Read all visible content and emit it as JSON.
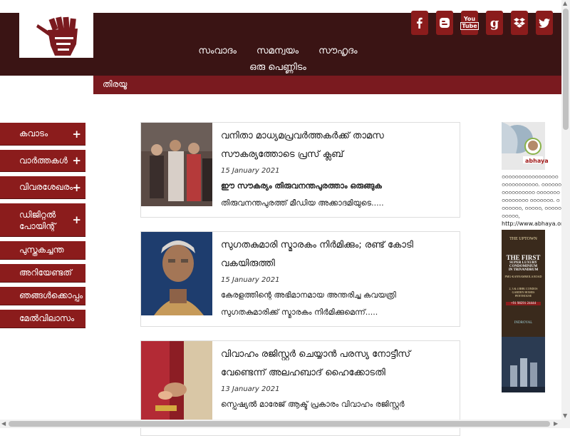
{
  "header": {
    "nav_row1": [
      "സംവാദം",
      "സമന്വയം",
      "സൗഹൃദം"
    ],
    "nav_row2": [
      "ഒരു പെണ്ണിടം"
    ],
    "social": [
      "facebook-icon",
      "blogger-icon",
      "youtube-icon",
      "google-icon",
      "dropbox-icon",
      "twitter-icon"
    ],
    "social_labels": {
      "youtube_top": "You",
      "youtube_bottom": "Tube",
      "google": "g"
    },
    "accent": "#3a1414",
    "button_color": "#8b1c1c"
  },
  "subbar": {
    "label": "തിരയൂ"
  },
  "sidemenu": [
    {
      "label": "കവാടം",
      "plus": "+"
    },
    {
      "label": "വാർത്തകൾ",
      "plus": "+"
    },
    {
      "label": "വിവരശേഖരം",
      "plus": "+"
    },
    {
      "label": "ഡിജിറ്റൽ പോയിന്റ്",
      "plus": "+"
    },
    {
      "label": "പുസ്തകച്ചന്ത",
      "plus": ""
    },
    {
      "label": "അറിയേണ്ടത്",
      "plus": ""
    },
    {
      "label": "ഞങ്ങൾക്കൊപ്പം",
      "plus": ""
    },
    {
      "label": "മേൽവിലാസം",
      "plus": ""
    }
  ],
  "articles": [
    {
      "title": "വനിതാ മാധ്യമപ്രവർത്തകർക്ക് താമസ സൗകര്യത്തോടെ പ്രസ് ക്ലബ്",
      "date": "15 January 2021",
      "excerpt_bold": "ഈ സൗകര്യം തിരുവനന്തപുരത്താം ഒരുങ്ങുക",
      "excerpt": "തിരുവനന്തപുരത്ത് മീഡിയ അക്കാദമിയുടെ....."
    },
    {
      "title": "സുഗതകുമാരി സ്മാരകം നിർമിക്കും; രണ്ട് കോടി വകയിരുത്തി",
      "date": "15 January 2021",
      "excerpt_bold": "",
      "excerpt": "കേരളത്തിന്റെ അഭിമാനമായ അന്തരിച്ച കവയത്രി സുഗതകുമാരിക്ക് സ്മാരകം നിർമിക്കുമെന്ന്....."
    },
    {
      "title": "വിവാഹം രജിസ്റ്റർ ചെയ്യാൻ പരസ്യ നോട്ടീസ് വേണ്ടെന്ന് അലഹബാദ് ഹൈക്കോടതി",
      "date": "13 January 2021",
      "excerpt_bold": "",
      "excerpt": "സ്പെഷ്യൽ മാരേജ് ആക്ട് പ്രകാരം വിവാഹം രജിസ്റ്റർ"
    }
  ],
  "ads": {
    "abhaya_brand": "abhaya",
    "abhaya_tagline": "ഠഠഠഠഠഠഠഠഠഠഠഠഠഠഠഠഠ ഠഠഠഠഠഠഠഠഠഠഠ. ഠഠഠഠഠഠഠഠഠഠഠഠഠഠഠഠ ഠഠഠഠഠഠഠഠഠഠഠഠഠഠഠ ഠഠഠഠഠഠഠ. ഠഠഠഠഠഠഠ, ഠഠഠഠഠ, ഠഠഠഠഠഠഠഠഠഠ,",
    "abhaya_link": "http://www.abhaya.org",
    "uptown": {
      "brand": "THE UPTOWN",
      "headline": [
        "THE FIRST",
        "SUPER LUXURY",
        "CONDOMINIUM",
        "IN TRIVANDRUM"
      ],
      "road": "PMG-KANNAMMOLA ROAD",
      "condos": "2, 3 & 4 BHK CONDOS",
      "garden": "GARDEN HOMES",
      "penthouse": "PENTHOUSE",
      "call": "+91 98291 24444",
      "developer": "INDROYAL"
    }
  }
}
